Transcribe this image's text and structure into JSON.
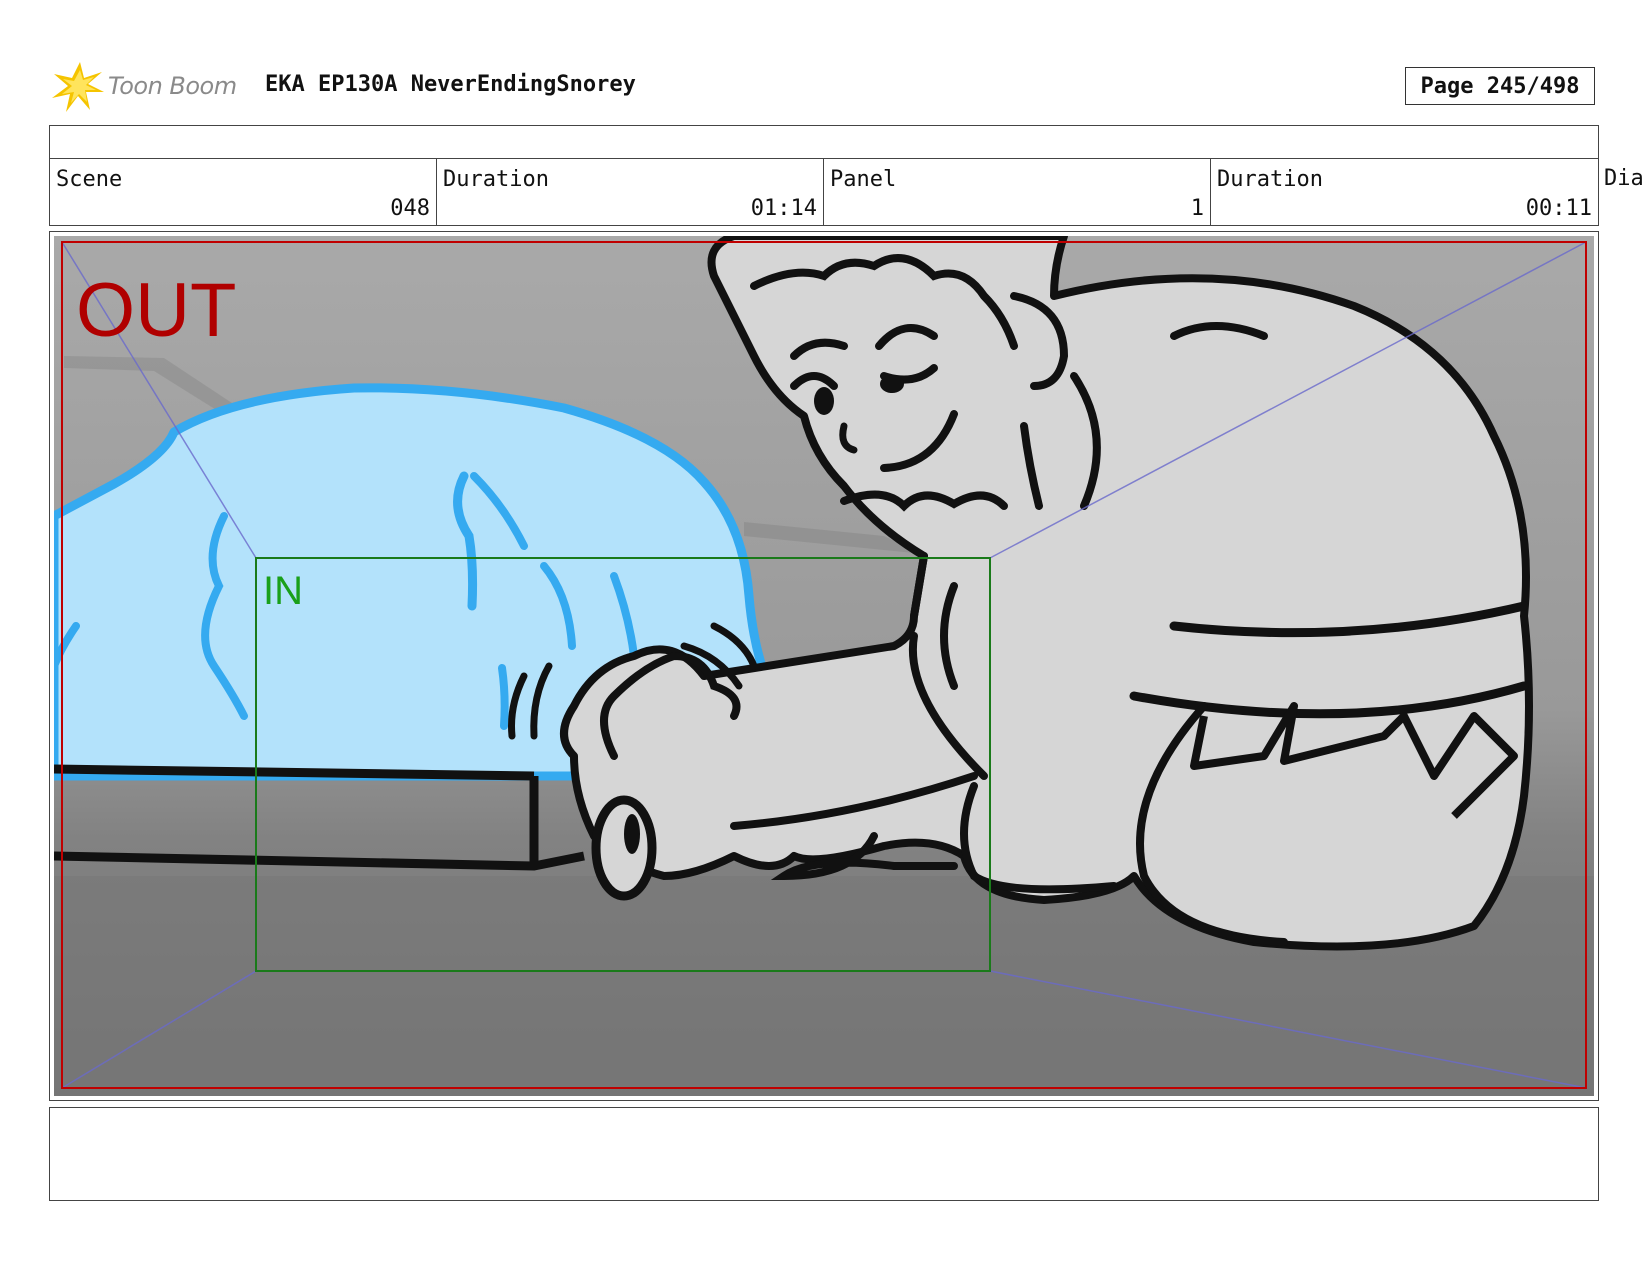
{
  "header": {
    "logo_text": "Toon Boom",
    "project_title": "EKA EP130A NeverEndingSnorey",
    "page_label": "Page 245/498"
  },
  "info_row": {
    "scene": {
      "label": "Scene",
      "value": "048"
    },
    "scene_duration": {
      "label": "Duration",
      "value": "01:14"
    },
    "panel": {
      "label": "Panel",
      "value": "1"
    },
    "panel_duration": {
      "label": "Duration",
      "value": "00:11"
    },
    "dialogue_label_partial": "Dia"
  },
  "panel": {
    "out_label": "OUT",
    "in_label": "IN",
    "colors": {
      "out_frame": "#c00000",
      "in_frame": "#1a7a1a",
      "in_text": "#1aa01a",
      "guide_lines": "#6a6acc",
      "ice": "#b3e2fb",
      "ice_outline": "#35aaf0"
    }
  },
  "caption": ""
}
